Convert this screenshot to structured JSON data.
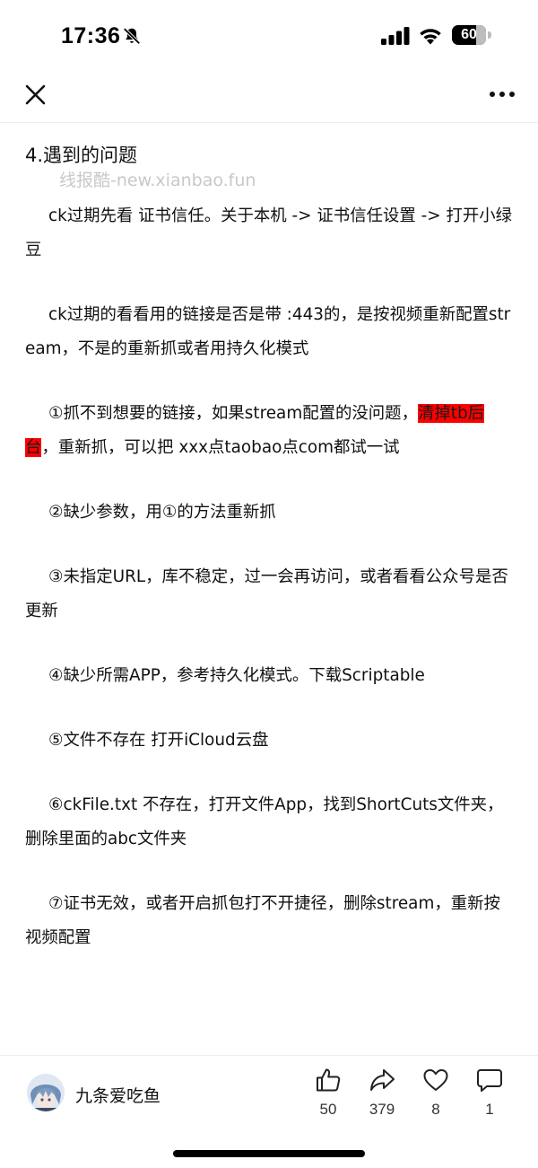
{
  "status_bar": {
    "time": "17:36",
    "battery": "60"
  },
  "nav": {
    "close_icon": "close-icon",
    "more_icon": "more-horizontal-icon"
  },
  "article": {
    "heading": "4.遇到的问题",
    "watermark": "线报酷-new.xianbao.fun",
    "p1": "ck过期先看 证书信任。关于本机 -> 证书信任设置 -> 打开小绿豆",
    "p2": "ck过期的看看用的链接是否是带 :443的，是按视频重新配置stream，不是的重新抓或者用持久化模式",
    "p3_before": "①抓不到想要的链接，如果stream配置的没问题，",
    "p3_highlight": "清掉tb后台",
    "p3_after": "，重新抓，可以把 xxx点taobao点com都试一试",
    "p4": "②缺少参数，用①的方法重新抓",
    "p5": "③未指定URL，库不稳定，过一会再访问，或者看看公众号是否更新",
    "p6": "④缺少所需APP，参考持久化模式。下载Scriptable",
    "p7": "⑤文件不存在 打开iCloud云盘",
    "p8": "⑥ckFile.txt 不存在，打开文件App，找到ShortCuts文件夹，删除里面的abc文件夹",
    "p9": "⑦证书无效，或者开启抓包打不开捷径，删除stream，重新按视频配置"
  },
  "footer": {
    "author": "九条爱吃鱼",
    "likes": "50",
    "shares": "379",
    "favorites": "8",
    "comments": "1"
  },
  "colors": {
    "highlight": "#ff0000",
    "watermark": "#c8c8c8"
  }
}
